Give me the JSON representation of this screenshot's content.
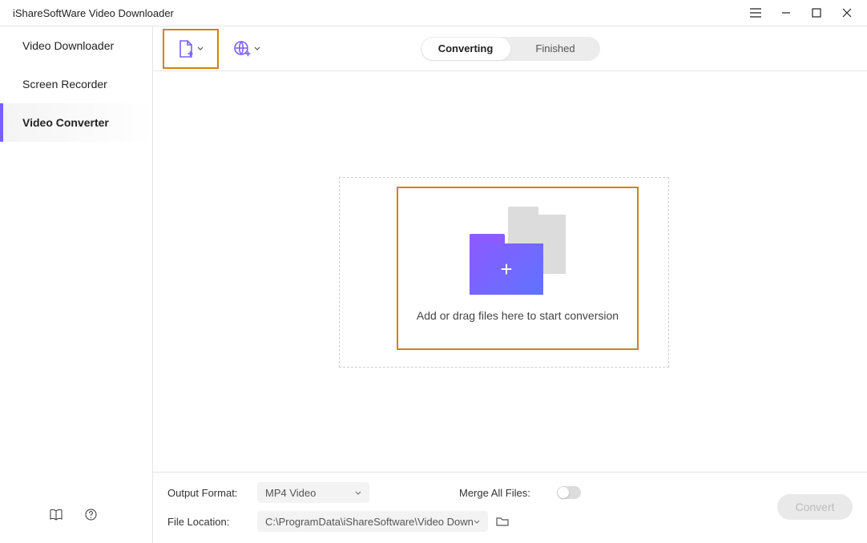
{
  "title": "iShareSoftWare Video Downloader",
  "sidebar": {
    "items": [
      {
        "label": "Video Downloader"
      },
      {
        "label": "Screen Recorder"
      },
      {
        "label": "Video Converter"
      }
    ]
  },
  "tabs": {
    "converting": "Converting",
    "finished": "Finished"
  },
  "dropzone": {
    "text": "Add or drag files here to start conversion"
  },
  "footer": {
    "output_format_label": "Output Format:",
    "output_format_value": "MP4 Video",
    "merge_label": "Merge All Files:",
    "file_location_label": "File Location:",
    "file_location_value": "C:\\ProgramData\\iShareSoftware\\Video Down",
    "convert_label": "Convert"
  }
}
